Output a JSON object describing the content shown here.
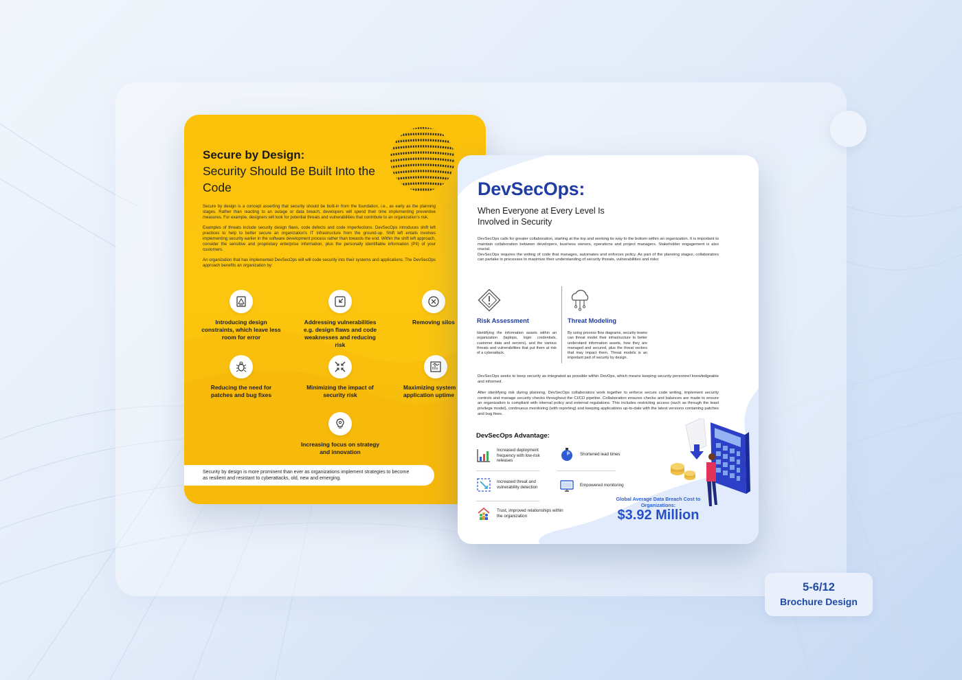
{
  "page_badge": {
    "page": "5-6/12",
    "label": "Brochure Design"
  },
  "left_page": {
    "title_bold": "Secure by Design:",
    "title_rest": "Security Should Be Built Into the Code",
    "paragraphs": [
      "Secure by design is a concept asserting that security should be built-in from the foundation, i.e., as early as the planning stages. Rather than reacting to an outage or data breach, developers will spend their time implementing preventive measures. For example, designers will look for potential threats and vulnerabilities that contribute to an organization's risk.",
      "Examples of threats include security design flaws, code defects and code imperfections. DevSecOps introduces shift left practices to help to better secure an organization's IT infrastructure from the ground-up. Shift left entails involves implementing security earlier in the software development process rather than towards the end. Within the shift left approach, consider the sensitive and proprietary enterprise information, plus the personally identifiable information (PII) of your customers.",
      "An organization that has implemented DevSecOps will will code security into their systems and applications. The DevSecOps approach benefits an organization by:"
    ],
    "features": [
      {
        "icon": "blueprint-icon",
        "label": "Introducing design constraints, which leave less room for error"
      },
      {
        "icon": "shrink-arrows-icon",
        "label": "Addressing vulnerabilities e.g. design flaws and code weaknesses and reducing risk"
      },
      {
        "icon": "close-circle-icon",
        "label": "Removing silos"
      },
      {
        "icon": "bug-icon",
        "label": "Reducing the need for patches and bug fixes"
      },
      {
        "icon": "converge-arrows-icon",
        "label": "Minimizing the impact of security risk"
      },
      {
        "icon": "system-chart-icon",
        "label": "Maximizing system and application uptime"
      },
      {
        "icon": "lightbulb-gear-icon",
        "label": "Increasing focus on strategy and innovation"
      }
    ],
    "footer_note": "Security by design is more prominent than ever as organizations implement strategies to become as resilient and resistant to cyberattacks, old, new and emerging."
  },
  "right_page": {
    "title": "DevSecOps:",
    "subtitle": "When Everyone at Every Level Is Involved in Security",
    "intro": [
      "DevSecOps calls for greater collaboration, starting at the top and working its way to the bottom within an organization. It is important to maintain collaboration between developers, business owners, operations and project managers. Stakeholder engagement is also crucial.",
      "DevSecOps requires the writing of code that manages, automates and enforces policy. As part of the planning stages, collaborators can partake in processes to maximize their understanding of security threats, vulnerabilities and risks:"
    ],
    "columns": [
      {
        "icon": "warning-diamond-icon",
        "heading": "Risk Assessment",
        "text": "Identifying the information assets within an organization (laptops, login credentials, customer data and servers), and the various threats and vulnerabilities that put them at risk of a cyberattack."
      },
      {
        "icon": "cloud-network-icon",
        "heading": "Threat Modeling",
        "text": "By using process flow diagrams, security teams can threat model their infrastructure to better understand information assets, how they are managed and secured, plus the threat vectors that may impact them. Threat models is an important part of security by design."
      }
    ],
    "middle": [
      "DevSecOps seeks to keep security as integrated as possible within DevOps, which means keeping security personnel knowledgeable and informed.",
      "After identifying risk during planning, DevSecOps collaborators work together to enforce secure code writing, implement security controls and manage security checks throughout the CI/CD pipeline. Collaboration ensures checks and balances are made to ensure an organization is compliant with internal policy and external regulations. This includes restricting access (such as through the least privilege model), continuous monitoring (with reporting) and keeping applications up-to-date with the latest versions containing patches and bug fixes."
    ],
    "advantages_title": "DevSecOps Advantage:",
    "advantages": [
      {
        "icon": "growth-chart-icon",
        "label": "Increased deployment frequency with low-risk releases"
      },
      {
        "icon": "stopwatch-icon",
        "label": "Shortened lead times"
      },
      {
        "icon": "threat-detection-icon",
        "label": "Increased threat and vulnerability detection"
      },
      {
        "icon": "monitor-icon",
        "label": "Empowered monitoring"
      },
      {
        "icon": "team-house-icon",
        "label": "Trust, improved relationships within the organization"
      }
    ],
    "breach_label": "Global Average Data Breach Cost to Organizations:",
    "breach_value": "$3.92 Million"
  },
  "colors": {
    "accent_blue": "#1f3da3",
    "highlight_blue": "#2450c9",
    "yellow": "#fcc10a"
  }
}
